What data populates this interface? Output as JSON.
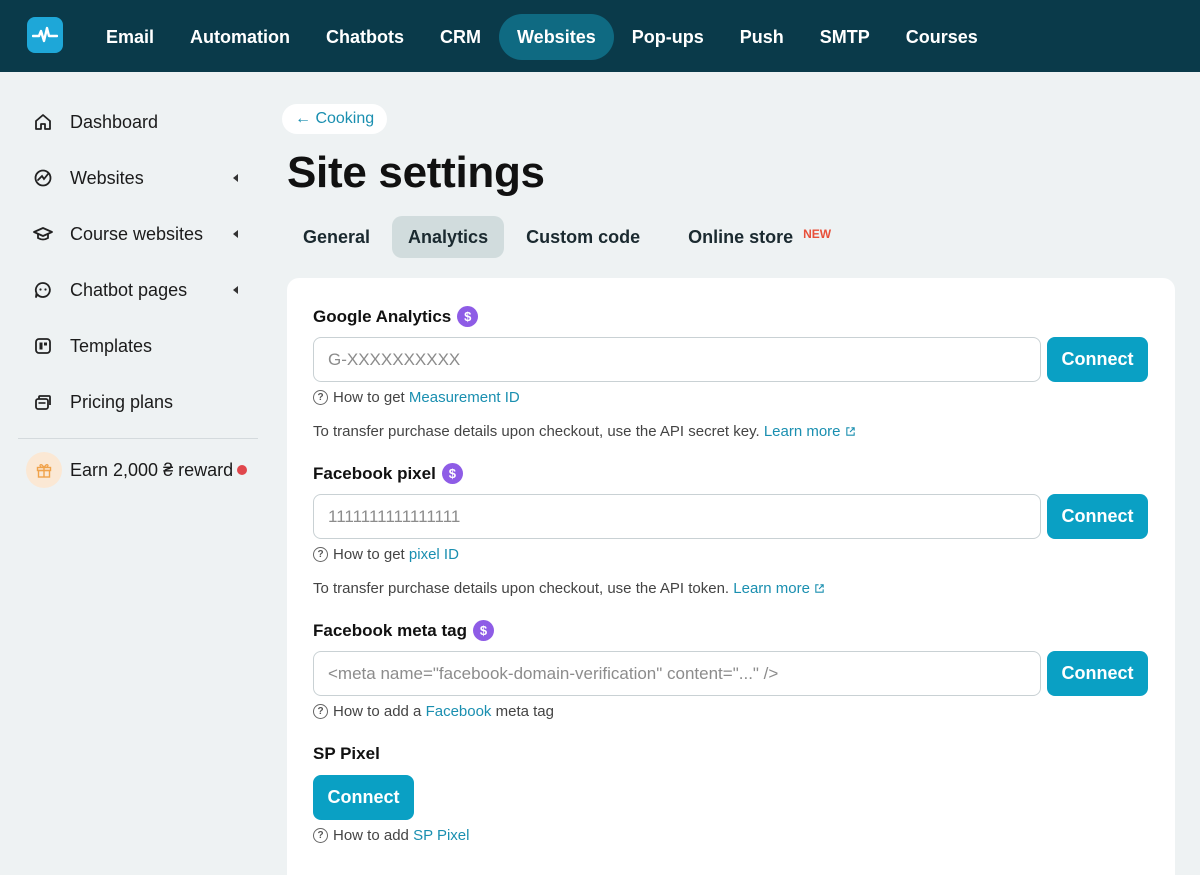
{
  "nav": {
    "items": [
      {
        "label": "Email"
      },
      {
        "label": "Automation"
      },
      {
        "label": "Chatbots"
      },
      {
        "label": "CRM"
      },
      {
        "label": "Websites"
      },
      {
        "label": "Pop-ups"
      },
      {
        "label": "Push"
      },
      {
        "label": "SMTP"
      },
      {
        "label": "Courses"
      }
    ],
    "active": "Websites"
  },
  "sidebar": {
    "items": [
      {
        "label": "Dashboard",
        "icon": "home-icon"
      },
      {
        "label": "Websites",
        "icon": "websites-icon"
      },
      {
        "label": "Course websites",
        "icon": "graduation-cap-icon"
      },
      {
        "label": "Chatbot pages",
        "icon": "chatbot-icon"
      },
      {
        "label": "Templates",
        "icon": "templates-icon"
      },
      {
        "label": "Pricing plans",
        "icon": "pricing-icon"
      }
    ],
    "reward": "Earn 2,000 ₴ reward"
  },
  "breadcrumb": {
    "label": "← Cooking"
  },
  "page": {
    "title": "Site settings"
  },
  "tabs": {
    "items": [
      {
        "label": "General"
      },
      {
        "label": "Analytics"
      },
      {
        "label": "Custom code"
      },
      {
        "label": "Online store"
      }
    ],
    "new_badge": "NEW",
    "active": "Analytics"
  },
  "google": {
    "title": "Google Analytics",
    "placeholder": "G-XXXXXXXXXX",
    "button": "Connect",
    "help_prefix": "How to get",
    "help_link": "Measurement ID",
    "note": "To transfer purchase details upon checkout, use the API secret key.",
    "note_link": "Learn more"
  },
  "fbpixel": {
    "title": "Facebook pixel",
    "placeholder": "1111111111111111",
    "button": "Connect",
    "help_prefix": "How to get",
    "help_link": "pixel ID",
    "note": "To transfer purchase details upon checkout, use the API token.",
    "note_link": "Learn more"
  },
  "fbmeta": {
    "title": "Facebook meta tag",
    "placeholder": "<meta name=\"facebook-domain-verification\" content=\"...\" />",
    "button": "Connect",
    "help_prefix": "How to add a",
    "help_link": "Facebook",
    "help_suffix": "meta tag"
  },
  "sppixel": {
    "title": "SP Pixel",
    "button": "Connect",
    "help_prefix": "How to add",
    "help_link": "SP Pixel"
  },
  "colors": {
    "topbar": "#0a3a4a",
    "active_nav": "#0f6a82",
    "accent": "#0aa0c4",
    "link": "#1a8fb0",
    "premium_badge": "#8e5ce6",
    "new_badge": "#e8503a"
  }
}
